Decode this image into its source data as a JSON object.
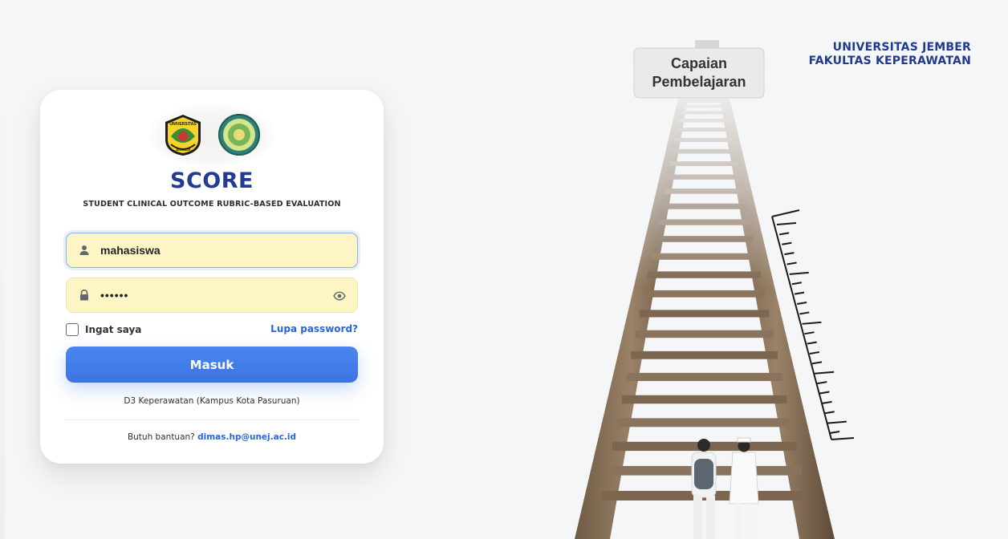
{
  "header": {
    "university": "UNIVERSITAS JEMBER",
    "faculty": "FAKULTAS KEPERAWATAN"
  },
  "hero": {
    "sign_line1": "Capaian",
    "sign_line2": "Pembelajaran"
  },
  "card": {
    "logo_unej_text_top": "UNIVERSITAS",
    "logo_unej_text_bottom": "JEMBER",
    "title": "SCORE",
    "subtitle": "STUDENT CLINICAL OUTCOME RUBRIC-BASED EVALUATION",
    "username_value": "mahasiswa",
    "password_value": "••••••",
    "remember_label": "Ingat saya",
    "forgot_label": "Lupa password?",
    "submit_label": "Masuk",
    "campus": "D3 Keperawatan (Kampus Kota Pasuruan)",
    "help_prefix": "Butuh bantuan?",
    "help_email": "dimas.hp@unej.ac.id"
  },
  "colors": {
    "brand_navy": "#243b94",
    "link_blue": "#2a66d8",
    "button_blue": "#4a86ef",
    "input_fill": "#fdf6c4"
  },
  "icons": {
    "username": "user-icon",
    "password": "lock-icon",
    "reveal": "eye-icon"
  }
}
